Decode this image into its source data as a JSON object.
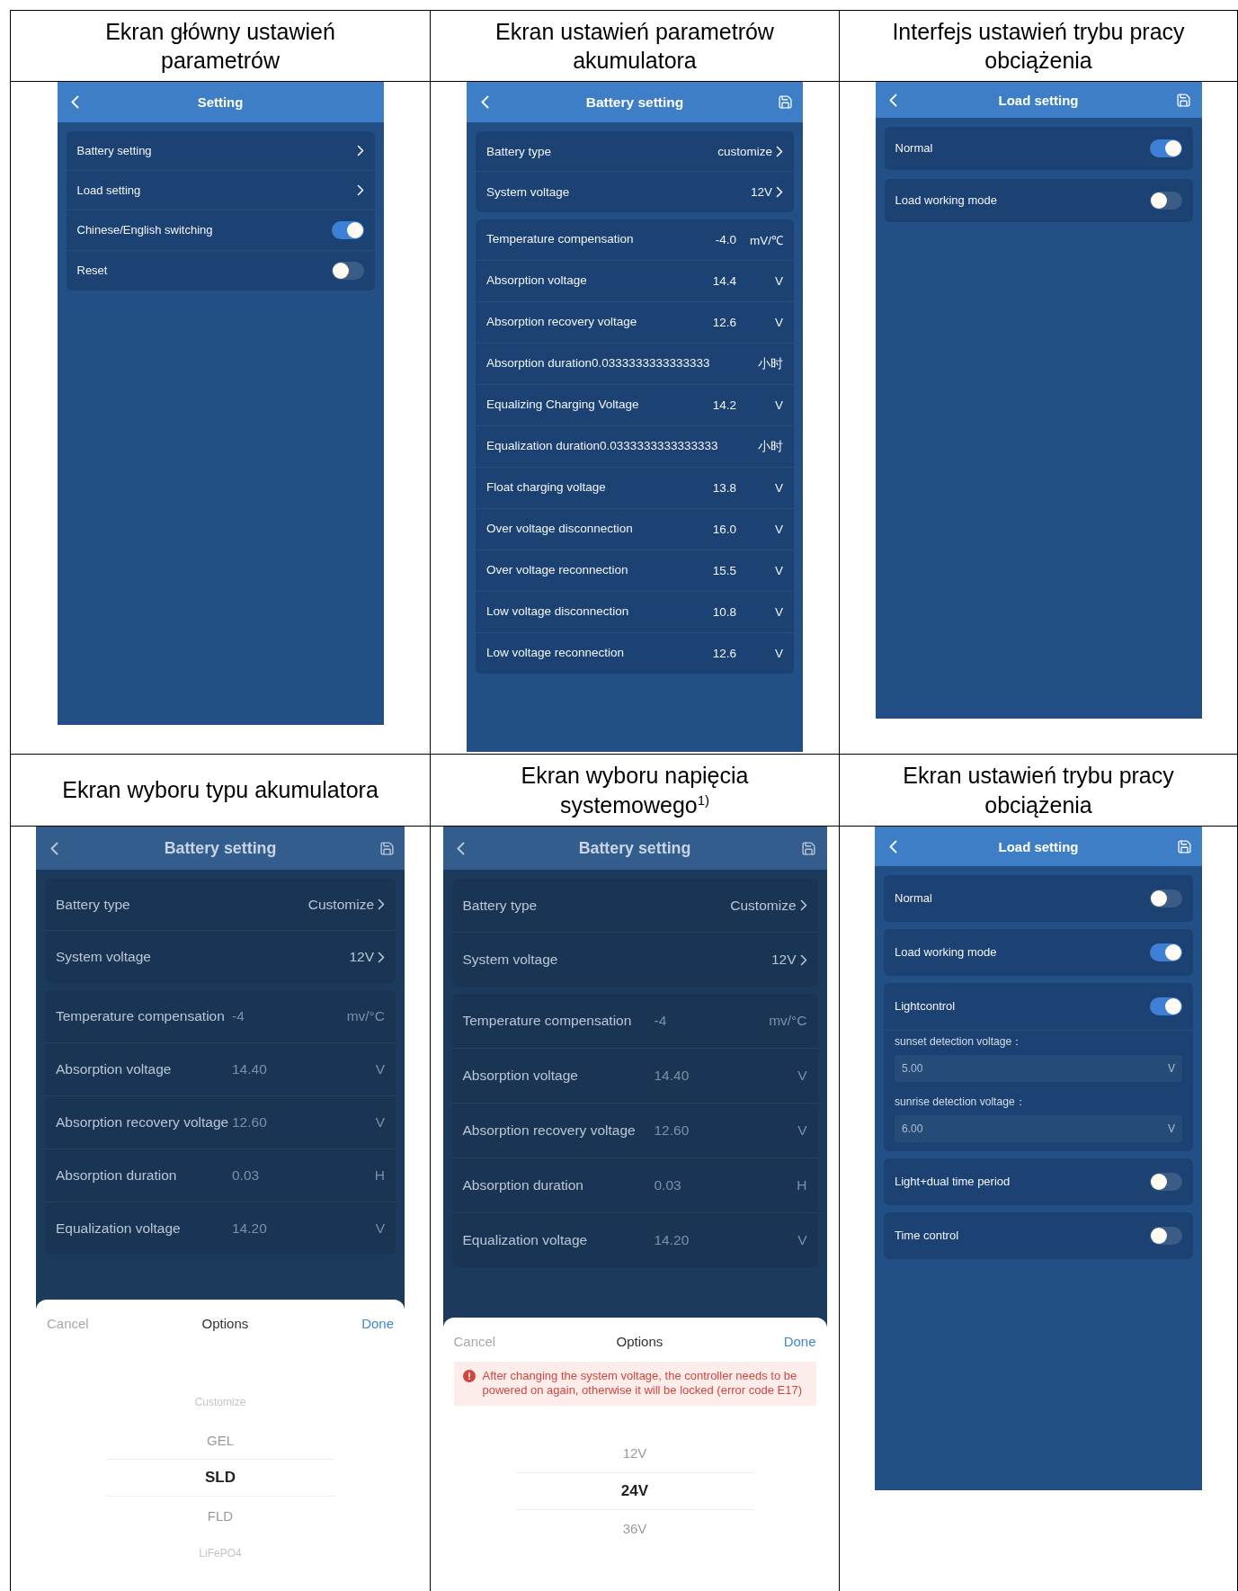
{
  "cells": [
    {
      "header": "Ekran główny ustawień\nparametrów",
      "screen": {
        "title": "Setting",
        "save_icon": false,
        "groups": [
          {
            "rows": [
              {
                "kind": "link",
                "label": "Battery setting"
              },
              {
                "kind": "link",
                "label": "Load setting"
              },
              {
                "kind": "toggle",
                "label": "Chinese/English switching",
                "on": true
              },
              {
                "kind": "toggle",
                "label": "Reset",
                "on": false
              }
            ]
          }
        ]
      }
    },
    {
      "header": "Ekran ustawień parametrów\nakumulatora",
      "screen": {
        "title": "Battery setting",
        "save_icon": true,
        "groups": [
          {
            "rows": [
              {
                "kind": "link",
                "label": "Battery type",
                "value": "customize"
              },
              {
                "kind": "link",
                "label": "System voltage",
                "value": "12V"
              }
            ]
          },
          {
            "rows": [
              {
                "kind": "value",
                "label": "Temperature compensation",
                "value": "-4.0",
                "unit": "mV/℃"
              },
              {
                "kind": "value",
                "label": "Absorption voltage",
                "value": "14.4",
                "unit": "V"
              },
              {
                "kind": "value",
                "label": "Absorption recovery voltage",
                "value": "12.6",
                "unit": "V"
              },
              {
                "kind": "value",
                "label": "Absorption duration0.0333333333333333",
                "unit": "小时"
              },
              {
                "kind": "value",
                "label": "Equalizing Charging Voltage",
                "value": "14.2",
                "unit": "V"
              },
              {
                "kind": "value",
                "label": "Equalization duration0.0333333333333333",
                "unit": "小时"
              },
              {
                "kind": "value",
                "label": "Float charging voltage",
                "value": "13.8",
                "unit": "V"
              },
              {
                "kind": "value",
                "label": "Over voltage disconnection",
                "value": "16.0",
                "unit": "V"
              },
              {
                "kind": "value",
                "label": "Over voltage reconnection",
                "value": "15.5",
                "unit": "V"
              },
              {
                "kind": "value",
                "label": "Low voltage disconnection",
                "value": "10.8",
                "unit": "V"
              },
              {
                "kind": "value",
                "label": "Low voltage reconnection",
                "value": "12.6",
                "unit": "V"
              }
            ]
          }
        ]
      }
    },
    {
      "header": "Interfejs ustawień trybu pracy\nobciążenia",
      "screen": {
        "title": "Load setting",
        "save_icon": true,
        "groups": [
          {
            "rows": [
              {
                "kind": "toggle",
                "label": "Normal",
                "on": true
              }
            ]
          },
          {
            "rows": [
              {
                "kind": "toggle",
                "label": "Load working mode",
                "on": false
              }
            ]
          }
        ]
      }
    },
    {
      "header": "Ekran wyboru typu akumulatora",
      "screen": {
        "title": "Battery setting",
        "save_icon": true,
        "groups": [
          {
            "rows": [
              {
                "kind": "link",
                "label": "Battery type",
                "value": "Customize"
              },
              {
                "kind": "link",
                "label": "System voltage",
                "value": "12V"
              }
            ]
          },
          {
            "rows": [
              {
                "kind": "value",
                "label": "Temperature compensation",
                "value": "-4",
                "unit": "mv/°C"
              },
              {
                "kind": "value",
                "label": "Absorption voltage",
                "value": "14.40",
                "unit": "V"
              },
              {
                "kind": "value",
                "label": "Absorption recovery voltage",
                "value": "12.60",
                "unit": "V"
              },
              {
                "kind": "value",
                "label": "Absorption duration",
                "value": "0.03",
                "unit": "H"
              },
              {
                "kind": "value",
                "label": "Equalization voltage",
                "value": "14.20",
                "unit": "V"
              }
            ]
          }
        ],
        "sheet": {
          "cancel": "Cancel",
          "title": "Options",
          "done": "Done",
          "options": [
            {
              "label": "Customize",
              "selected": false
            },
            {
              "label": "GEL",
              "selected": false
            },
            {
              "label": "SLD",
              "selected": true
            },
            {
              "label": "FLD",
              "selected": false
            },
            {
              "label": "LiFePO4",
              "selected": false
            }
          ]
        }
      }
    },
    {
      "header": "Ekran wyboru napięcia\nsystemowego$^{1)}$",
      "screen": {
        "title": "Battery setting",
        "save_icon": true,
        "groups": [
          {
            "rows": [
              {
                "kind": "link",
                "label": "Battery type",
                "value": "Customize"
              },
              {
                "kind": "link",
                "label": "System voltage",
                "value": "12V"
              }
            ]
          },
          {
            "rows": [
              {
                "kind": "value",
                "label": "Temperature compensation",
                "value": "-4",
                "unit": "mv/°C"
              },
              {
                "kind": "value",
                "label": "Absorption voltage",
                "value": "14.40",
                "unit": "V"
              },
              {
                "kind": "value",
                "label": "Absorption recovery voltage",
                "value": "12.60",
                "unit": "V"
              },
              {
                "kind": "value",
                "label": "Absorption duration",
                "value": "0.03",
                "unit": "H"
              },
              {
                "kind": "value",
                "label": "Equalization voltage",
                "value": "14.20",
                "unit": "V"
              }
            ]
          }
        ],
        "sheet": {
          "cancel": "Cancel",
          "title": "Options",
          "done": "Done",
          "warning": "After changing the system voltage, the controller needs to be powered on again, otherwise it will be locked (error code E17)",
          "options": [
            {
              "label": "12V",
              "selected": false
            },
            {
              "label": "24V",
              "selected": true
            },
            {
              "label": "36V",
              "selected": false
            }
          ]
        }
      }
    },
    {
      "header": "Ekran ustawień trybu pracy\nobciążenia",
      "screen": {
        "title": "Load setting",
        "save_icon": true,
        "groups": [
          {
            "rows": [
              {
                "kind": "toggle",
                "label": "Normal",
                "on": false
              }
            ]
          },
          {
            "rows": [
              {
                "kind": "toggle",
                "label": "Load working mode",
                "on": true
              }
            ]
          },
          {
            "rows": [
              {
                "kind": "toggle",
                "label": "Lightcontrol",
                "on": true
              },
              {
                "kind": "field",
                "label": "sunset detection voltage：",
                "value": "5.00",
                "unit": "V"
              },
              {
                "kind": "field",
                "label": "sunrise detection voltage：",
                "value": "6.00",
                "unit": "V"
              }
            ]
          },
          {
            "rows": [
              {
                "kind": "toggle",
                "label": "Light+dual time period",
                "on": false
              }
            ]
          },
          {
            "rows": [
              {
                "kind": "toggle",
                "label": "Time control",
                "on": false
              }
            ]
          }
        ]
      }
    }
  ]
}
